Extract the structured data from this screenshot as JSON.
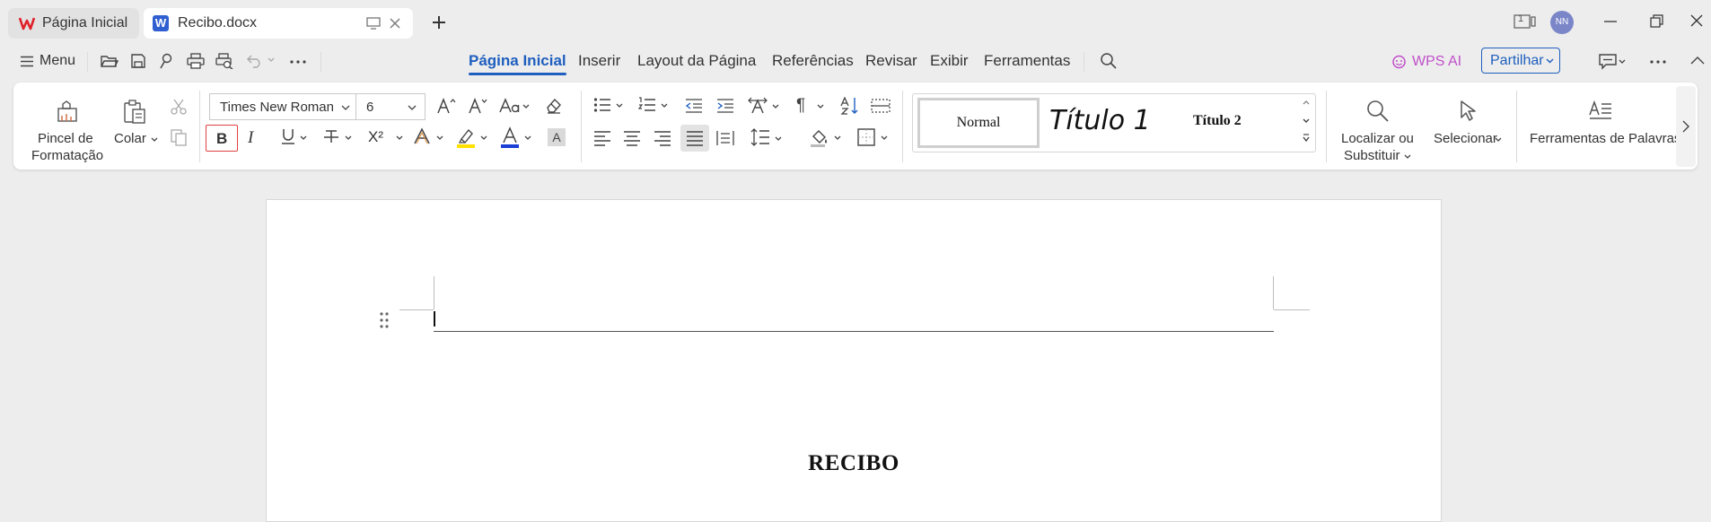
{
  "tabs": [
    {
      "label": "Página Inicial",
      "icon": "wps-logo-icon"
    },
    {
      "label": "Recibo.docx",
      "icon": "word-doc-icon"
    }
  ],
  "menu": {
    "label": "Menu"
  },
  "ribbon_tabs": [
    "Página Inicial",
    "Inserir",
    "Layout da Página",
    "Referências",
    "Revisar",
    "Exibir",
    "Ferramentas"
  ],
  "active_ribbon_tab": "Página Inicial",
  "wps_ai": "WPS AI",
  "share_button": "Partilhar",
  "user_avatar": "NN",
  "window_badge": "1",
  "clipboard": {
    "format_painter": [
      "Pincel de",
      "Formatação"
    ],
    "paste": "Colar"
  },
  "font": {
    "family": "Times New Roman",
    "size": "6"
  },
  "styles": {
    "normal": "Normal",
    "heading1": "Título 1",
    "heading2": "Título 2"
  },
  "find_replace": [
    "Localizar ou",
    "Substituir"
  ],
  "select": "Selecionar",
  "word_tools": "Ferramentas de Palavras",
  "document": {
    "title": "RECIBO"
  },
  "colors": {
    "accent": "#1f5fbf",
    "wps_red": "#e0202a",
    "word_blue": "#2f5fd0",
    "ai_pink": "#c04fc9",
    "highlight": "#ffe100",
    "font_color": "#1a3fd6",
    "avatar": "#7b86c9"
  }
}
